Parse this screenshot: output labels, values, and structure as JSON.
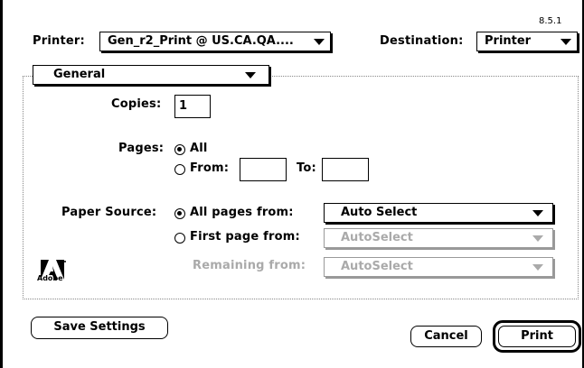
{
  "dialog": {
    "version": "8.5.1",
    "printer_label": "Printer:",
    "printer_value": "Gen_r2_Print @ US.CA.QA....",
    "destination_label": "Destination:",
    "destination_value": "Printer",
    "panel_value": "General"
  },
  "general": {
    "copies_label": "Copies:",
    "copies_value": "1",
    "pages_label": "Pages:",
    "pages_all_label": "All",
    "pages_from_label": "From:",
    "pages_from_value": "",
    "pages_to_label": "To:",
    "pages_to_value": "",
    "paper_source_label": "Paper Source:",
    "all_pages_from_label": "All pages from:",
    "all_pages_from_value": "Auto Select",
    "first_page_from_label": "First page from:",
    "first_page_from_value": "AutoSelect",
    "remaining_from_label": "Remaining from:",
    "remaining_from_value": "AutoSelect",
    "logo_text": "Adobe"
  },
  "buttons": {
    "save_settings": "Save Settings",
    "cancel": "Cancel",
    "print": "Print"
  },
  "icons": {
    "logo": "adobe-logo-icon",
    "popup_arrow": "triangle-down-icon"
  }
}
